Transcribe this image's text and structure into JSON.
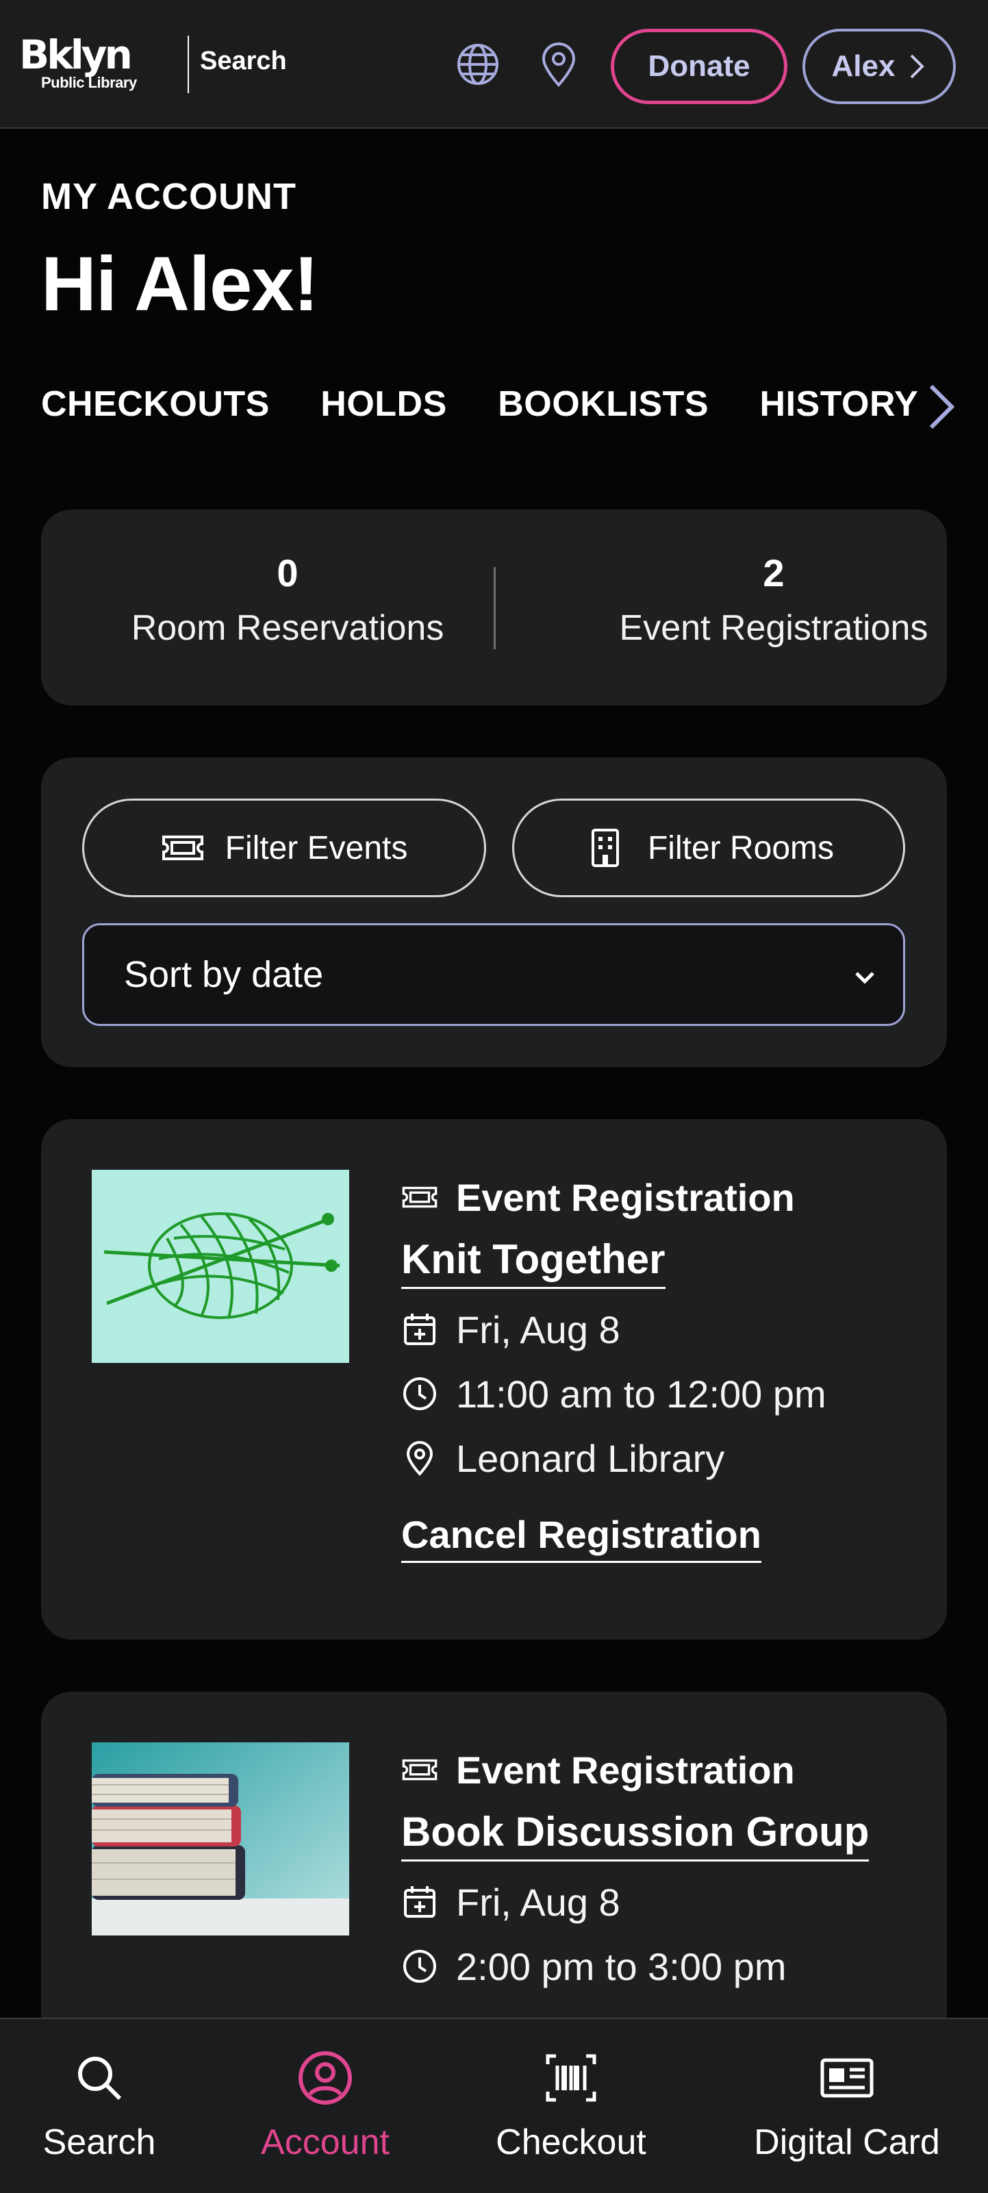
{
  "header": {
    "logo_main": "Bklyn",
    "logo_sub": "Public Library",
    "search_label": "Search",
    "donate_label": "Donate",
    "user_label": "Alex"
  },
  "account": {
    "eyebrow": "MY ACCOUNT",
    "greeting": "Hi Alex!",
    "tabs": [
      "CHECKOUTS",
      "HOLDS",
      "BOOKLISTS",
      "HISTORY"
    ]
  },
  "stats": {
    "room_count": "0",
    "room_label": "Room Reservations",
    "event_count": "2",
    "event_label": "Event Registrations"
  },
  "filters": {
    "events_label": "Filter Events",
    "rooms_label": "Filter Rooms",
    "sort_value": "Sort by date"
  },
  "events": [
    {
      "type": "Event Registration",
      "title": "Knit Together",
      "date": "Fri, Aug 8",
      "time": "11:00 am to 12:00 pm",
      "location": "Leonard Library",
      "action": "Cancel Registration"
    },
    {
      "type": "Event Registration",
      "title": "Book Discussion Group",
      "date": "Fri, Aug 8",
      "time": "2:00 pm to 3:00 pm"
    }
  ],
  "bottom_nav": {
    "search": "Search",
    "account": "Account",
    "checkout": "Checkout",
    "digital_card": "Digital Card"
  },
  "colors": {
    "accent_pink": "#e0458f",
    "accent_lavender": "#9ea3d6",
    "card_bg": "#1e1f21",
    "page_bg": "#050505"
  }
}
